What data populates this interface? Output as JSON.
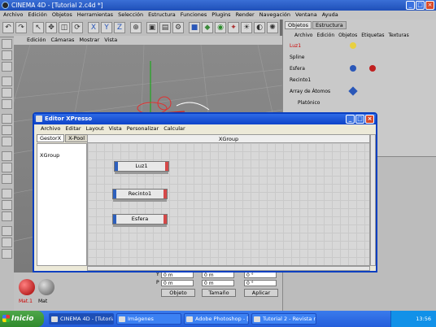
{
  "window": {
    "title": "CINEMA 4D - [Tutorial 2.c4d *]"
  },
  "menu": [
    "Archivo",
    "Edición",
    "Objetos",
    "Herramientas",
    "Selección",
    "Estructura",
    "Funciones",
    "Plugins",
    "Render",
    "Navegación",
    "Ventana",
    "Ayuda"
  ],
  "viewport_menu": [
    "Edición",
    "Cámaras",
    "Mostrar",
    "Vista"
  ],
  "right_tabs": [
    "Objetos",
    "Estructura"
  ],
  "object_menu": [
    "Archivo",
    "Edición",
    "Objetos",
    "Etiquetas",
    "Texturas"
  ],
  "objects": [
    "Luz1",
    "Spline",
    "Esfera",
    "Recinto1",
    "Array de Átomos",
    "Platónico"
  ],
  "xpresso": {
    "title": "Editor XPresso",
    "menu": [
      "Archivo",
      "Editar",
      "Layout",
      "Vista",
      "Personalizar",
      "Calcular"
    ],
    "tabs": [
      "GestorX",
      "X-Pool"
    ],
    "tree_item": "XGroup",
    "group_header": "XGroup",
    "nodes": [
      "Luz1",
      "Recinto1",
      "Esfera"
    ]
  },
  "coords": {
    "y1": "0 m",
    "y2": "0 m",
    "y3": "0 °",
    "r1": "0 m",
    "r2": "0 m",
    "r3": "0 °",
    "p1": "0 m",
    "p2": "0 m",
    "p3": "0 °",
    "label_y": "Y",
    "label_p": "P"
  },
  "bottom_buttons": {
    "object": "Objeto",
    "size": "Tamaño",
    "apply": "Aplicar"
  },
  "materials": [
    "Mat.1",
    "Mat"
  ],
  "taskbar": {
    "start": "Inicio",
    "items": [
      "CINEMA 4D - [Tutoria...",
      "Imágenes",
      "Adobe Photoshop - [...",
      "Tutorial 2 - Revista n..."
    ],
    "time": "13:56"
  }
}
